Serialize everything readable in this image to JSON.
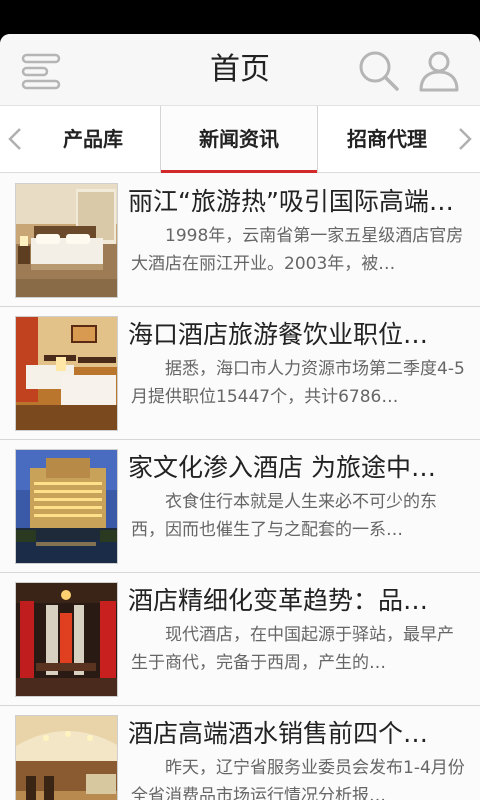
{
  "header": {
    "title": "首页"
  },
  "tabs": [
    {
      "label": "产品库",
      "active": false
    },
    {
      "label": "新闻资讯",
      "active": true
    },
    {
      "label": "招商代理",
      "active": false
    }
  ],
  "articles": [
    {
      "title": "丽江“旅游热”吸引国际高端…",
      "summary": "1998年，云南省第一家五星级酒店官房大酒店在丽江开业。2003年，被…"
    },
    {
      "title": "海口酒店旅游餐饮业职位…",
      "summary": "据悉，海口市人力资源市场第二季度4-5月提供职位15447个，共计6786…"
    },
    {
      "title": "家文化渗入酒店 为旅途中…",
      "summary": "衣食住行本就是人生来必不可少的东西，因而也催生了与之配套的一系…"
    },
    {
      "title": "酒店精细化变革趋势：品…",
      "summary": "现代酒店，在中国起源于驿站，最早产生于商代，完备于西周，产生的…"
    },
    {
      "title": "酒店高端酒水销售前四个…",
      "summary": "昨天，辽宁省服务业委员会发布1-4月份全省消费品市场运行情况分析报…"
    }
  ],
  "colors": {
    "accent": "#d22a2a",
    "header_bg": "#f7f7f7",
    "icon_gray": "#b5b5b5"
  }
}
